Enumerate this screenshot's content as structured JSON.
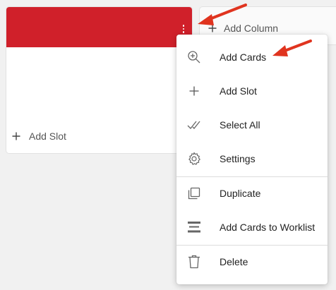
{
  "board": {
    "column": {
      "header_color": "#d0202a",
      "add_slot_label": "Add Slot"
    },
    "add_column_label": "Add Column"
  },
  "menu": {
    "items": [
      {
        "label": "Add Cards",
        "icon": "zoom-in-icon"
      },
      {
        "label": "Add Slot",
        "icon": "plus-icon"
      },
      {
        "label": "Select All",
        "icon": "double-check-icon"
      },
      {
        "label": "Settings",
        "icon": "gear-icon"
      },
      {
        "label": "Duplicate",
        "icon": "copy-icon"
      },
      {
        "label": "Add Cards to Worklist",
        "icon": "list-icon"
      },
      {
        "label": "Delete",
        "icon": "trash-icon"
      }
    ]
  },
  "annotation_color": "#e0341f"
}
